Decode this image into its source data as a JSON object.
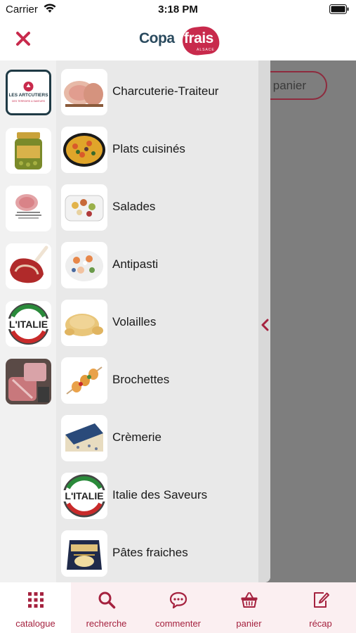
{
  "status_bar": {
    "carrier": "Carrier",
    "time": "3:18 PM"
  },
  "header": {
    "logo_text_left": "Copa",
    "logo_text_right": "frais",
    "logo_subtitle": "ALSACE"
  },
  "main": {
    "panier_label": "panier"
  },
  "brands": [
    {
      "name": "LES ARTCUTIERS",
      "subtitle": "DES TERROIRS & SAVEURS",
      "selected": true
    },
    {
      "name": "jar-product"
    },
    {
      "name": "ham-pack",
      "caption": "JAMBON AVEC NOIX/SAUCE"
    },
    {
      "name": "meat-rib"
    },
    {
      "name": "L'ITALIE"
    },
    {
      "name": "meat-counter"
    }
  ],
  "categories": [
    {
      "label": "Charcuterie-Traiteur",
      "icon": "ham-icon"
    },
    {
      "label": "Plats cuisinés",
      "icon": "paella-icon"
    },
    {
      "label": "Salades",
      "icon": "salad-icon"
    },
    {
      "label": "Antipasti",
      "icon": "antipasti-icon"
    },
    {
      "label": "Volailles",
      "icon": "chicken-icon"
    },
    {
      "label": "Brochettes",
      "icon": "skewer-icon"
    },
    {
      "label": "Crèmerie",
      "icon": "cheese-icon"
    },
    {
      "label": "Italie des Saveurs",
      "icon": "italie-icon",
      "badge": "L'ITALIE"
    },
    {
      "label": "Pâtes fraiches",
      "icon": "pasta-icon"
    }
  ],
  "tabs": [
    {
      "label": "catalogue",
      "icon": "grid-icon",
      "active": true
    },
    {
      "label": "recherche",
      "icon": "search-icon",
      "active": false
    },
    {
      "label": "commenter",
      "icon": "chat-icon",
      "active": false
    },
    {
      "label": "panier",
      "icon": "basket-icon",
      "active": false
    },
    {
      "label": "récap",
      "icon": "edit-icon",
      "active": false
    }
  ],
  "colors": {
    "accent": "#a5223f",
    "brand_red": "#c82a4c",
    "brand_navy": "#2a4a5e",
    "overlay": "#7e7e7e"
  }
}
